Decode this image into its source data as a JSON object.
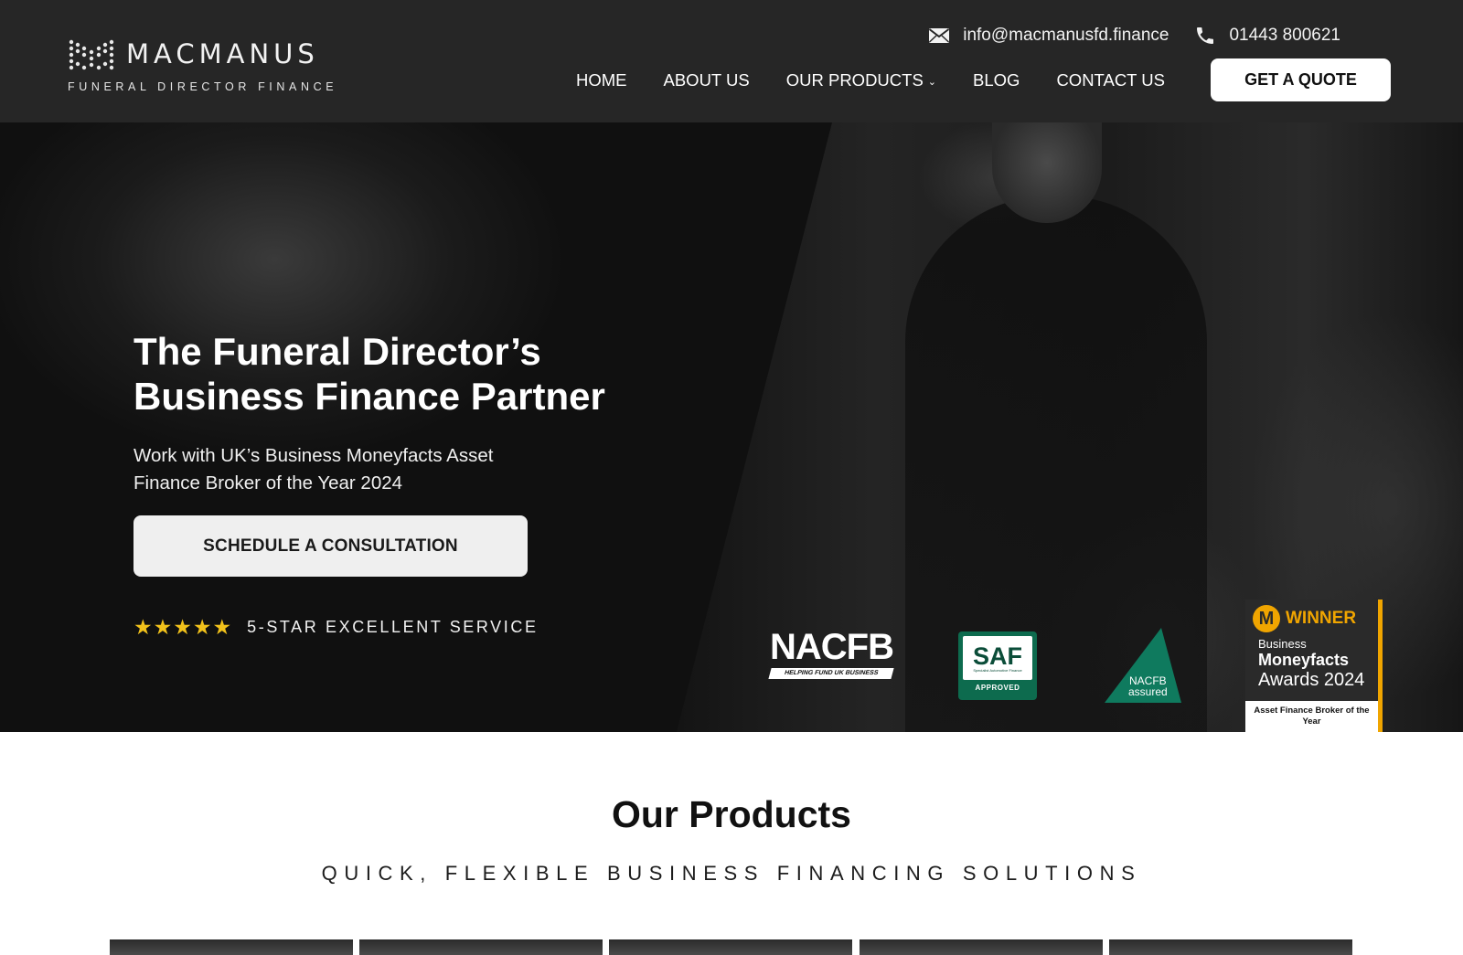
{
  "header": {
    "logo": {
      "name": "MACMANUS",
      "tagline": "FUNERAL DIRECTOR FINANCE"
    },
    "contact": {
      "email": "info@macmanusfd.finance",
      "email_icon": "envelope-icon",
      "phone": "01443 800621",
      "phone_icon": "phone-icon"
    },
    "nav": {
      "items": [
        {
          "label": "HOME"
        },
        {
          "label": "ABOUT US"
        },
        {
          "label": "OUR PRODUCTS",
          "dropdown_icon": "chevron-down-icon"
        },
        {
          "label": "BLOG"
        },
        {
          "label": "CONTACT US"
        }
      ],
      "cta_label": "GET A QUOTE"
    }
  },
  "hero": {
    "title_line1": "The Funeral Director’s",
    "title_line2": "Business Finance Partner",
    "subtitle": "Work with UK’s Business Moneyfacts Asset Finance Broker of the Year 2024",
    "cta_label": "SCHEDULE A CONSULTATION",
    "rating": {
      "stars": 5,
      "star_glyphs": "★★★★★",
      "label": "5-STAR EXCELLENT SERVICE"
    },
    "badges": {
      "nacfb": {
        "title": "NACFB",
        "tagline": "HELPING FUND UK BUSINESS"
      },
      "saf": {
        "title": "SAF",
        "tagline": "Specialist Automotive Finance",
        "status": "APPROVED"
      },
      "assured": {
        "line1": "NACFB",
        "line2": "assured"
      },
      "award": {
        "mark": "M",
        "label": "WINNER",
        "line1": "Business",
        "line2": "Moneyfacts",
        "line3": "Awards 2024",
        "footer": "Asset Finance Broker of the Year"
      }
    }
  },
  "products": {
    "title": "Our Products",
    "subtitle": "QUICK, FLEXIBLE BUSINESS FINANCING SOLUTIONS",
    "cards": [
      {},
      {},
      {},
      {},
      {}
    ]
  },
  "colors": {
    "header_bg": "#262626",
    "accent_star": "#f2c21b",
    "award_gold": "#f0a500",
    "saf_green": "#0d6b4e",
    "assured_green": "#0f7a5e"
  }
}
